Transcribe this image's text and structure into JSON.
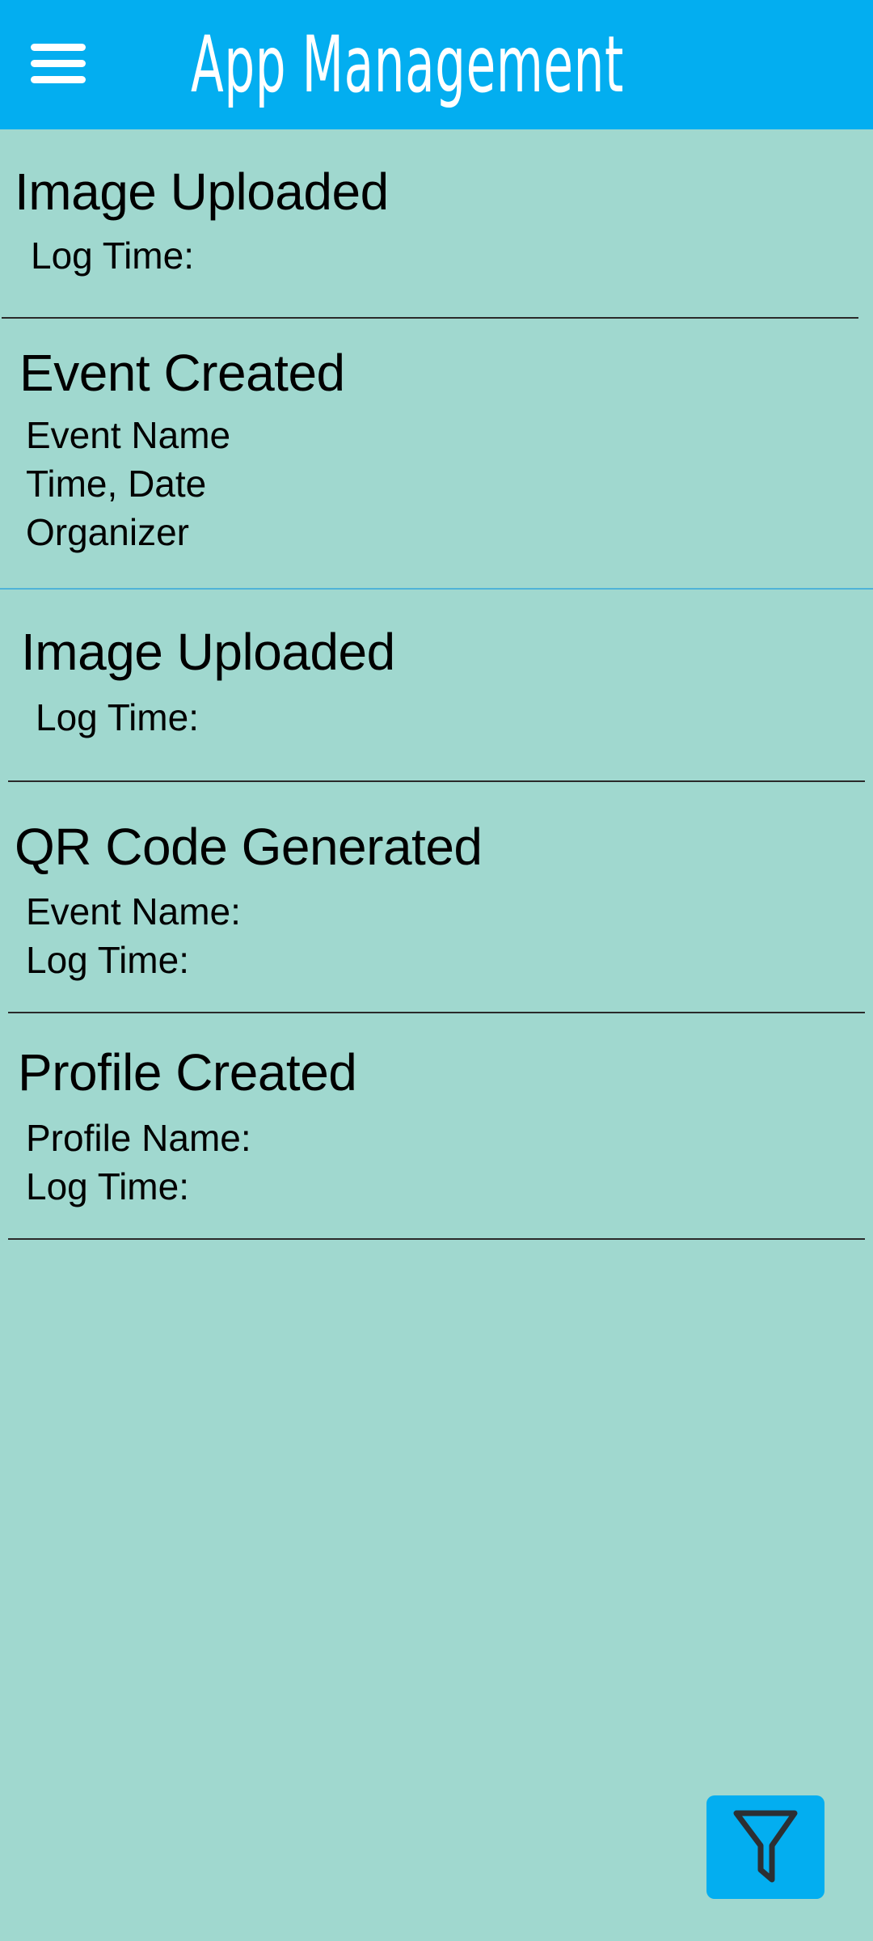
{
  "app_bar": {
    "title": "App Management",
    "menu_icon": "hamburger-menu-icon",
    "background": "#03aef0"
  },
  "logs": [
    {
      "title": "Image Uploaded",
      "lines": [
        "Log Time:"
      ]
    },
    {
      "title": "Event Created",
      "lines": [
        "Event Name",
        "Time, Date",
        "Organizer"
      ]
    },
    {
      "title": "Image Uploaded",
      "lines": [
        "Log Time:"
      ]
    },
    {
      "title": "QR Code Generated",
      "lines": [
        "Event Name:",
        "Log Time:"
      ]
    },
    {
      "title": "Profile Created",
      "lines": [
        "Profile Name:",
        "Log Time:"
      ]
    }
  ],
  "filter_button": {
    "icon": "filter-funnel-icon"
  },
  "colors": {
    "page_background": "#a0d8cf",
    "accent": "#03aef0"
  }
}
